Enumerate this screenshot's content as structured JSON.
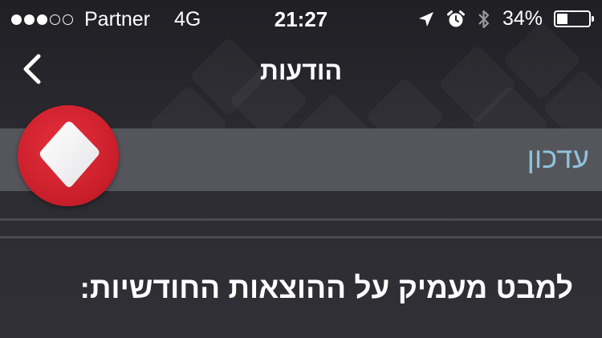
{
  "status_bar": {
    "carrier": "Partner",
    "network": "4G",
    "time": "21:27",
    "battery_percent": "34%",
    "battery_level": 0.34,
    "icons": [
      "location-arrow-icon",
      "alarm-clock-icon",
      "bluetooth-icon",
      "battery-icon"
    ]
  },
  "nav": {
    "title": "הודעות",
    "back_icon": "chevron-left-icon"
  },
  "section": {
    "label": "עדכון",
    "icon": "diamond-app-icon"
  },
  "message": {
    "headline": "למבט מעמיק על ההוצאות החודשיות:"
  },
  "colors": {
    "accent_blue": "#8fc3dd",
    "icon_red": "#d4202e",
    "band_gray": "#55565c",
    "background": "#2b2b30"
  }
}
